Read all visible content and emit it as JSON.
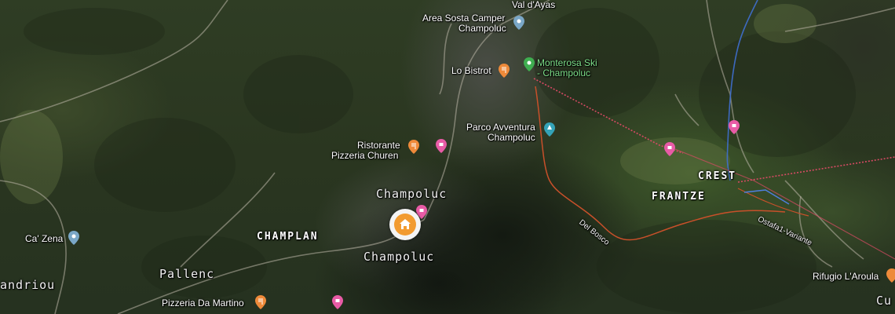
{
  "map": {
    "colors": {
      "food_pin": "#ee8a3a",
      "shop_pin": "#e85ba6",
      "poi_pin": "#7aa7c7",
      "ski_pin": "#3fae50",
      "park_pin": "#34a3b8",
      "home_marker": "#f29b30",
      "lift_line": "#d84a64",
      "trail_line": "#c8502a",
      "river": "#3f6fd0"
    },
    "labels": {
      "val_dayas": "Val d'Ayas",
      "area_sosta_1": "Area Sosta Camper",
      "area_sosta_2": "Champoluc",
      "lo_bistrot": "Lo Bistrot",
      "monterosa_1": "Monterosa Ski",
      "monterosa_2": "- Champoluc",
      "parco_1": "Parco Avventura",
      "parco_2": "Champoluc",
      "ristorante_1": "Ristorante",
      "ristorante_2": "Pizzeria Churen",
      "champoluc_upper": "Champoluc",
      "champoluc_lower": "Champoluc",
      "champlan": "CHAMPLAN",
      "ca_zena": "Ca' Zena",
      "pallenc": "Pallenc",
      "andriou": "andriou",
      "pizzeria_martino": "Pizzeria Da Martino",
      "crest": "CREST",
      "frantze": "FRANTZE",
      "del_bosco": "Del Bosco",
      "ostafa": "Ostafa1-Variante",
      "rifugio": "Rifugio L'Aroula",
      "cu": "Cu"
    },
    "icons": {
      "food": "restaurant-icon",
      "shop": "shopping-icon",
      "place": "place-icon",
      "ski": "ski-icon",
      "park": "park-icon",
      "home": "home-icon"
    }
  }
}
